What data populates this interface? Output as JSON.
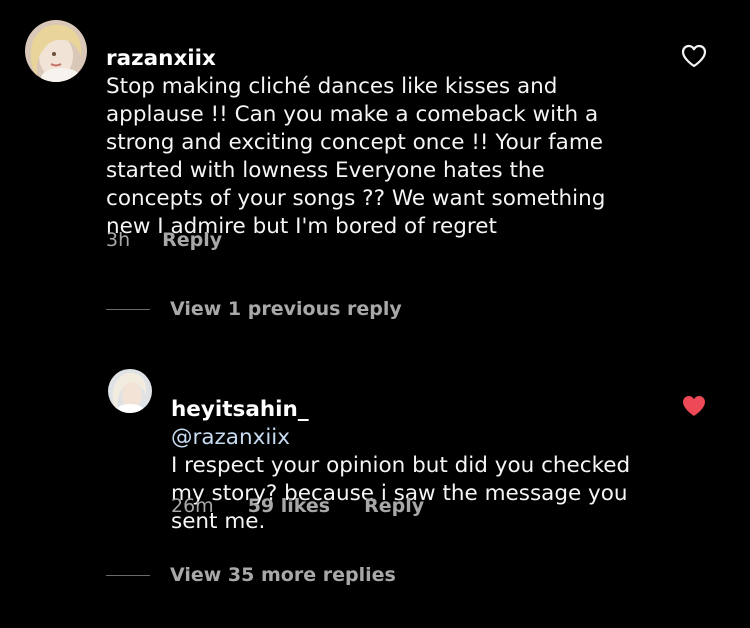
{
  "comment": {
    "username": "razanxiix",
    "text": "Stop making cliché dances like kisses and applause !! Can you make a comeback with a strong and exciting concept once !! Your fame started with lowness Everyone hates the concepts of your songs ?? We want something new I admire but I'm bored of regret",
    "time": "3h",
    "reply_label": "Reply",
    "like_icon": "heart-outline-icon"
  },
  "view_previous": "View 1 previous reply",
  "reply": {
    "username": "heyitsahin_",
    "mention": "@razanxiix",
    "text": "I respect your opinion but did you checked my story? because i saw the message you sent me.",
    "time": "26m",
    "likes": "59 likes",
    "reply_label": "Reply",
    "like_icon": "heart-filled-icon",
    "like_color": "#ed4956"
  },
  "view_more": "View 35 more replies"
}
